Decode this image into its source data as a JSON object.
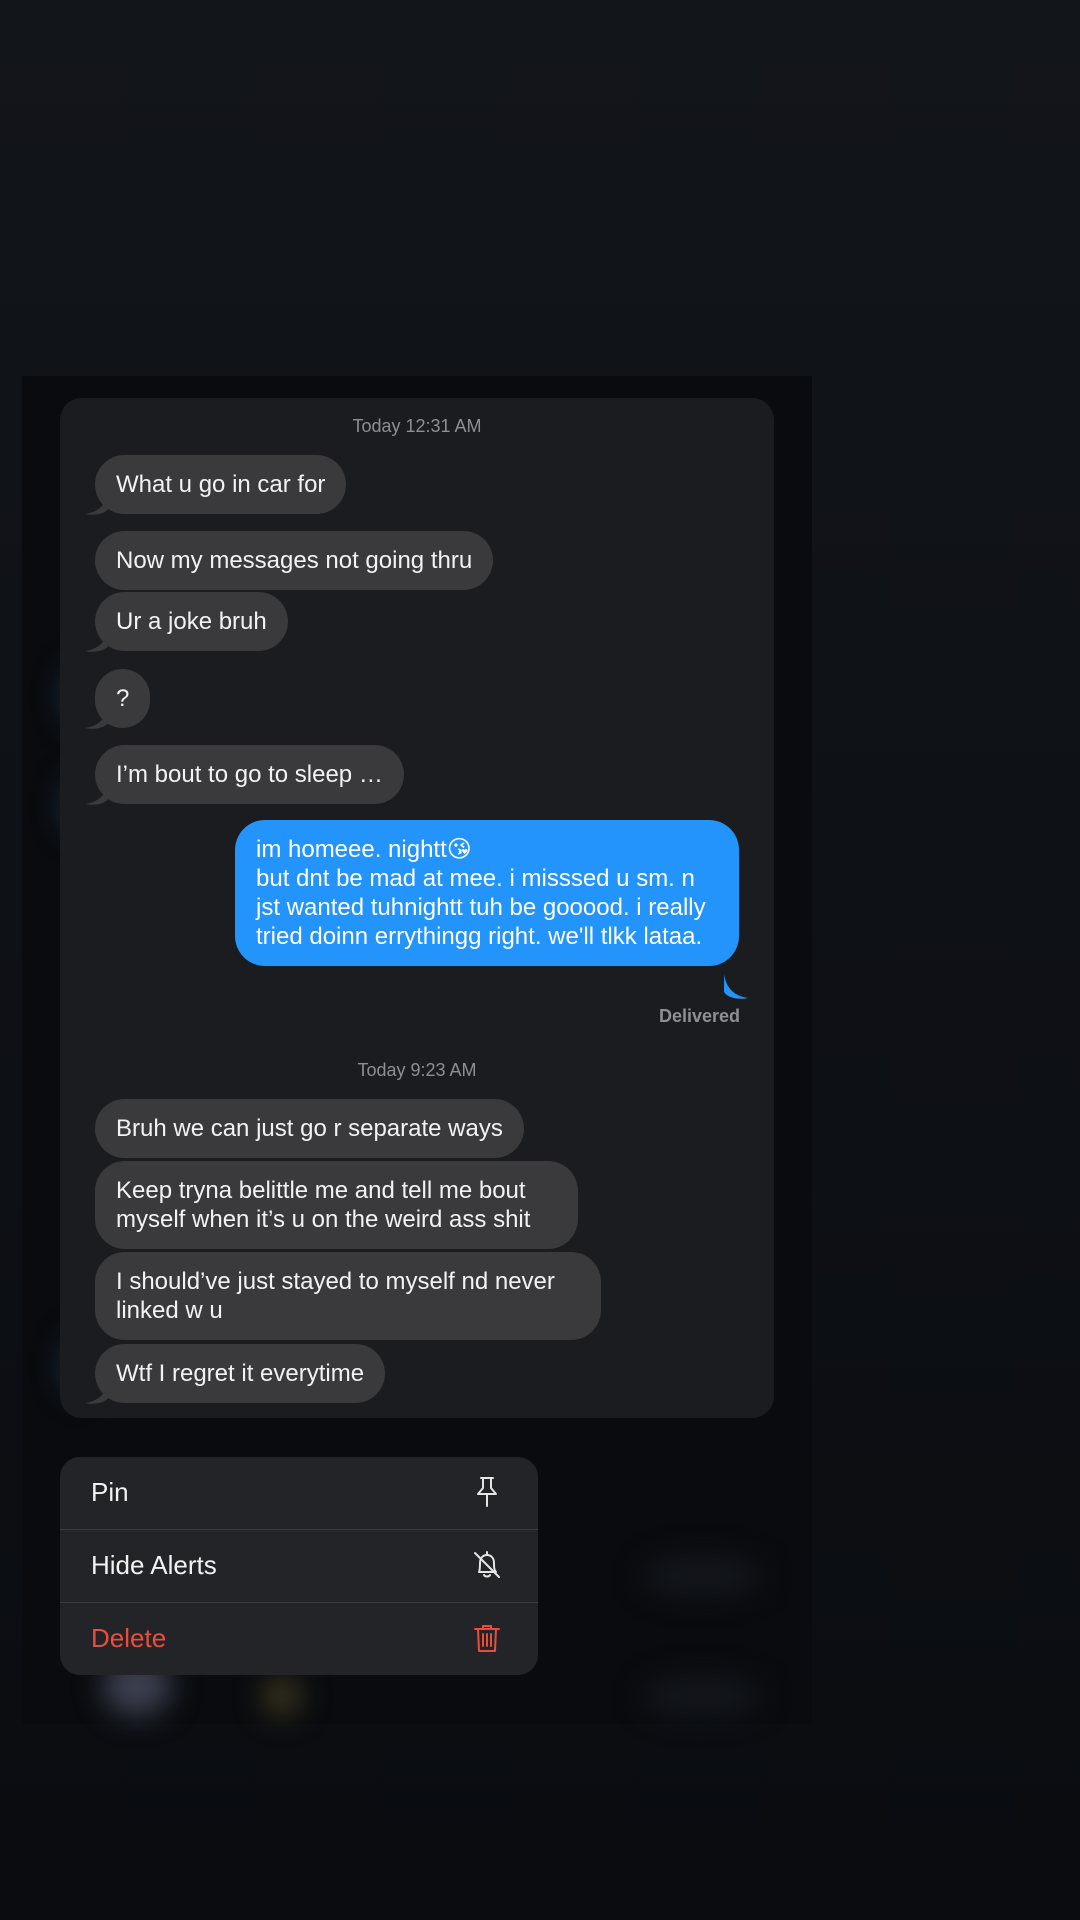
{
  "conversation": {
    "sections": [
      {
        "timestamp": "Today 12:31 AM"
      },
      {
        "timestamp": "Today 9:23 AM"
      }
    ],
    "messages": [
      {
        "text": "What u go in car for",
        "direction": "incoming"
      },
      {
        "text": "Now my messages not going thru",
        "direction": "incoming"
      },
      {
        "text": "Ur a joke bruh",
        "direction": "incoming"
      },
      {
        "text": "?",
        "direction": "incoming"
      },
      {
        "text": "I’m bout to go to sleep …",
        "direction": "incoming"
      },
      {
        "text": "im homeee. nightt😘\nbut dnt be mad at mee. i misssed u sm. n jst wanted tuhnightt tuh be gooood. i really tried doinn errythingg right. we'll tlkk lataa.",
        "direction": "outgoing"
      },
      {
        "text": "Bruh we can just go r separate ways",
        "direction": "incoming"
      },
      {
        "text": "Keep tryna belittle me and tell me bout myself when it’s u on the weird ass shit",
        "direction": "incoming"
      },
      {
        "text": "I should’ve just stayed to myself nd never linked w u",
        "direction": "incoming"
      },
      {
        "text": "Wtf I regret it everytime",
        "direction": "incoming"
      }
    ],
    "delivered_label": "Delivered"
  },
  "context_menu": {
    "items": [
      {
        "label": "Pin",
        "icon": "pin-icon",
        "color": "#f2f2f2"
      },
      {
        "label": "Hide Alerts",
        "icon": "bell-slash-icon",
        "color": "#f2f2f2"
      },
      {
        "label": "Delete",
        "icon": "trash-icon",
        "color": "#eb4d3d"
      }
    ]
  },
  "colors": {
    "incoming_bubble": "#3a3a3c",
    "outgoing_bubble": "#2294fb",
    "destructive": "#eb4d3d"
  }
}
